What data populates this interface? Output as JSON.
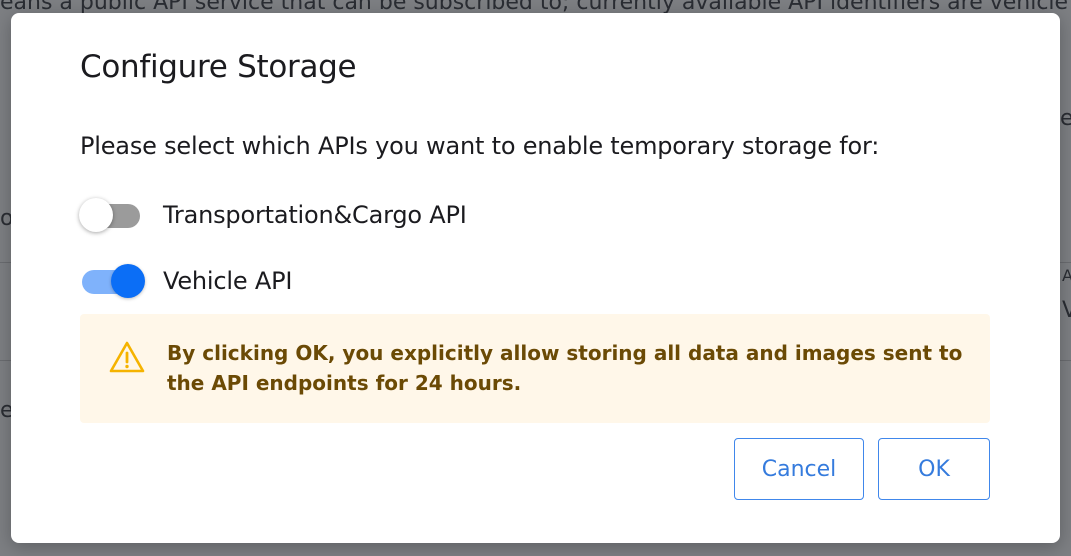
{
  "background": {
    "partial_text_top": "eans a public API service that can be subscribed to; currently available API identifiers are vehicle an",
    "partial_text_right_1": "e",
    "partial_text_left_1": "o",
    "partial_text_right_2": "A",
    "partial_text_right_3": "V",
    "partial_text_left_2": "e"
  },
  "dialog": {
    "title": "Configure Storage",
    "prompt": "Please select which APIs you want to enable temporary storage for:",
    "toggles": [
      {
        "label": "Transportation&Cargo API",
        "enabled": false
      },
      {
        "label": "Vehicle API",
        "enabled": true
      }
    ],
    "warning": {
      "icon": "warning-triangle-icon",
      "text": "By clicking OK, you explicitly allow storing all data and images sent to the API endpoints for 24 hours."
    },
    "buttons": {
      "cancel_label": "Cancel",
      "ok_label": "OK"
    }
  },
  "colors": {
    "accent": "#0b6ef6",
    "warning_bg": "#fff7e9",
    "warning_text": "#6b4a05",
    "warning_icon": "#f5b300"
  }
}
